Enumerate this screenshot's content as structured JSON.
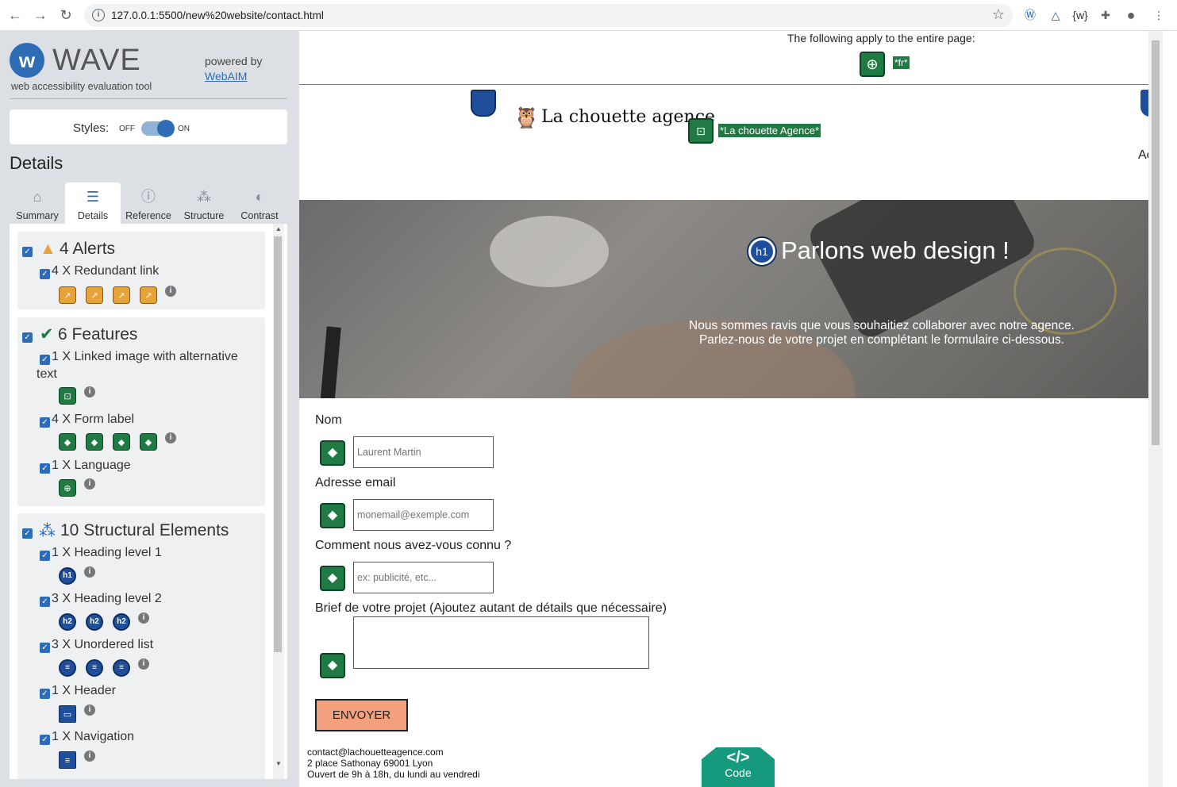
{
  "browser": {
    "url": "127.0.0.1:5500/new%20website/contact.html",
    "back_icon": "arrow-left-icon",
    "forward_icon": "arrow-right-icon",
    "reload_icon": "reload-icon"
  },
  "wave": {
    "title": "WAVE",
    "subtitle": "web accessibility evaluation tool",
    "powered_by": "powered by",
    "webaim": "WebAIM",
    "styles_label": "Styles:",
    "styles_off": "OFF",
    "styles_on": "ON",
    "details_heading": "Details",
    "tabs": [
      {
        "label": "Summary",
        "icon": "home-icon"
      },
      {
        "label": "Details",
        "icon": "list-icon"
      },
      {
        "label": "Reference",
        "icon": "info-icon"
      },
      {
        "label": "Structure",
        "icon": "hierarchy-icon"
      },
      {
        "label": "Contrast",
        "icon": "contrast-icon"
      }
    ],
    "alerts": {
      "title": "4 Alerts",
      "items": [
        {
          "label": "4 X Redundant link"
        }
      ]
    },
    "features": {
      "title": "6 Features",
      "items": [
        {
          "label": "1 X Linked image with alternative",
          "label2": "text"
        },
        {
          "label": "4 X Form label"
        },
        {
          "label": "1 X Language"
        }
      ]
    },
    "structure": {
      "title": "10 Structural Elements",
      "items": [
        {
          "label": "1 X Heading level 1",
          "badge": "h1"
        },
        {
          "label": "3 X Heading level 2",
          "badge": "h2"
        },
        {
          "label": "3 X Unordered list"
        },
        {
          "label": "1 X Header"
        },
        {
          "label": "1 X Navigation"
        }
      ]
    }
  },
  "page": {
    "apply_text": "The following apply to the entire page:",
    "lang_badge": "*fr*",
    "logo_text": "La chouette agence",
    "link_alt": "*La chouette Agence*",
    "nav_peek": "Accu",
    "h1_badge": "h1",
    "h1": "Parlons web design !",
    "hero_line1": "Nous sommes ravis que vous souhaitiez collaborer avec notre agence.",
    "hero_line2": "Parlez-nous de votre projet en complétant le formulaire ci-dessous.",
    "form": {
      "name_label": "Nom",
      "name_placeholder": "Laurent Martin",
      "email_label": "Adresse email",
      "email_placeholder": "monemail@exemple.com",
      "source_label": "Comment nous avez-vous connu ?",
      "source_placeholder": "ex: publicité, etc...",
      "brief_label": "Brief de votre projet (Ajoutez autant de détails que nécessaire)",
      "submit": "ENVOYER"
    },
    "footer": {
      "email": "contact@lachouetteagence.com",
      "address": "2 place Sathonay 69001 Lyon",
      "hours": "Ouvert de 9h à 18h, du lundi au vendredi"
    },
    "code_button": {
      "icon": "</>",
      "label": "Code"
    }
  },
  "colors": {
    "wave_blue": "#2e6db5",
    "feature_green": "#1f7a44",
    "alert_orange": "#e8a23a",
    "submit_bg": "#f4a07f",
    "code_teal": "#169a7e"
  }
}
